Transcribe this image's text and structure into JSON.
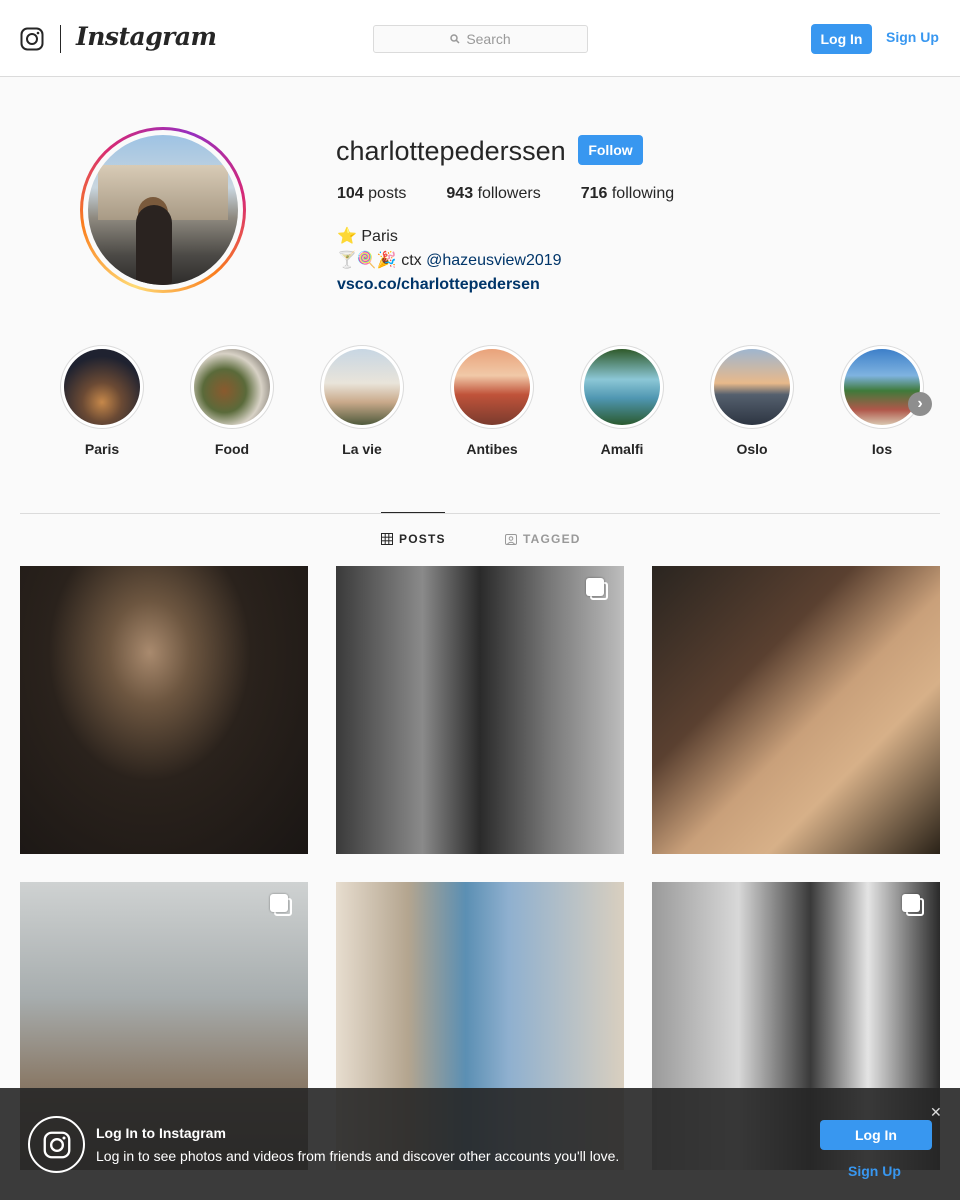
{
  "nav": {
    "brand": "Instagram",
    "search_placeholder": "Search",
    "login_label": "Log In",
    "signup_label": "Sign Up"
  },
  "profile": {
    "username": "charlottepederssen",
    "follow_label": "Follow",
    "stats": {
      "posts_count": "104",
      "posts_label": "posts",
      "followers_count": "943",
      "followers_label": "followers",
      "following_count": "716",
      "following_label": "following"
    },
    "bio": {
      "line1_emoji": "⭐",
      "line1_text": "Paris",
      "line2_emoji": "🍸🍭🎉",
      "line2_text": "ctx",
      "mention": "@hazeusview2019",
      "website": "vsco.co/charlottepedersen"
    }
  },
  "highlights": [
    {
      "label": "Paris"
    },
    {
      "label": "Food"
    },
    {
      "label": "La vie"
    },
    {
      "label": "Antibes"
    },
    {
      "label": "Amalfi"
    },
    {
      "label": "Oslo"
    },
    {
      "label": "Ios"
    }
  ],
  "tabs": {
    "posts_label": "POSTS",
    "tagged_label": "TAGGED"
  },
  "posts": [
    {
      "multi": false
    },
    {
      "multi": true
    },
    {
      "multi": false
    },
    {
      "multi": true
    },
    {
      "multi": false
    },
    {
      "multi": true
    }
  ],
  "banner": {
    "title": "Log In to Instagram",
    "text": "Log in to see photos and videos from friends and discover other accounts you'll love.",
    "login_label": "Log In",
    "signup_label": "Sign Up",
    "close_glyph": "✕"
  },
  "colors": {
    "accent": "#3897f0",
    "link": "#003569",
    "border": "#dbdbdb",
    "text": "#262626"
  }
}
